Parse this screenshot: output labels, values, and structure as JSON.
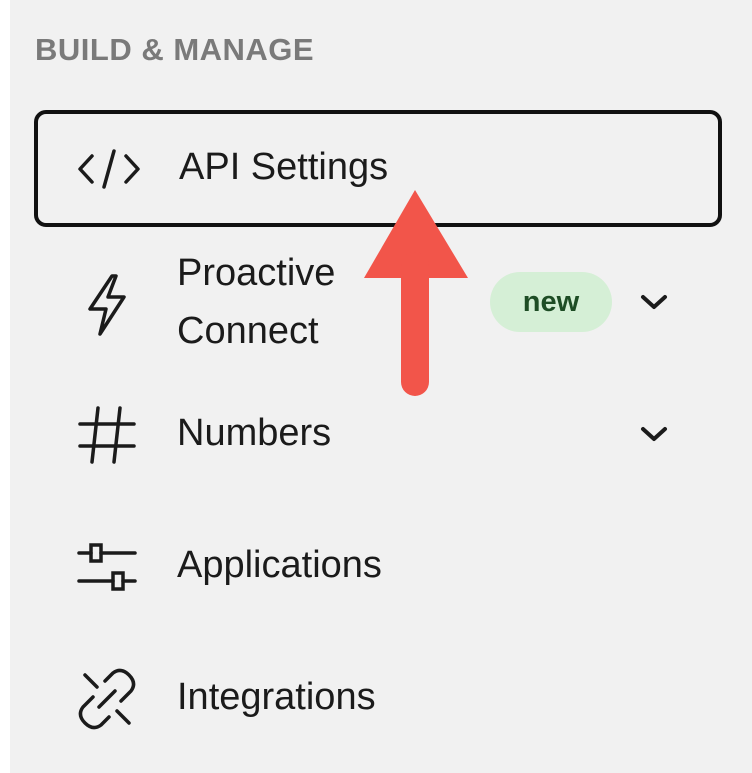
{
  "sidebar": {
    "section_title": "BUILD & MANAGE",
    "items": [
      {
        "label": "API Settings",
        "icon": "code-icon",
        "selected": true
      },
      {
        "label_line1": "Proactive",
        "label_line2": "Connect",
        "icon": "lightning-icon",
        "badge": "new",
        "expandable": true
      },
      {
        "label": "Numbers",
        "icon": "hash-icon",
        "expandable": true
      },
      {
        "label": "Applications",
        "icon": "applications-icon"
      },
      {
        "label": "Integrations",
        "icon": "link-icon"
      }
    ]
  },
  "annotation": {
    "arrow_color": "#f2554a",
    "points_to": "API Settings"
  },
  "colors": {
    "panel_bg": "#f1f1f1",
    "badge_bg": "#d5efd6",
    "badge_text": "#1e4d25",
    "selected_border": "#111111"
  }
}
